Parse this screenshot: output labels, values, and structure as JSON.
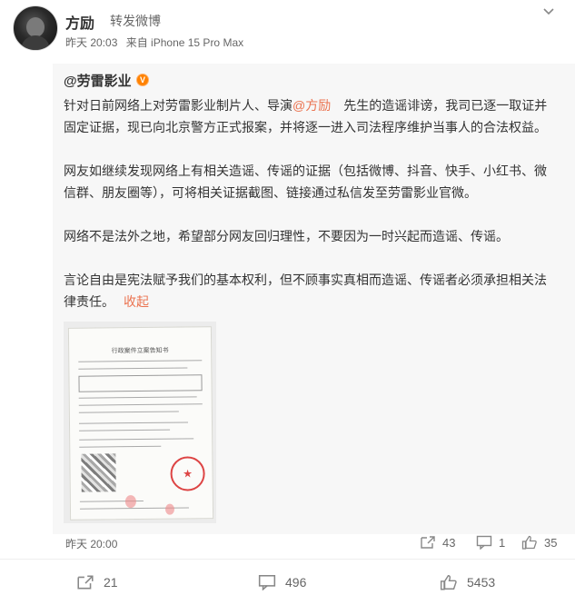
{
  "post": {
    "author": "方励",
    "repost_tag": "转发微博",
    "time": "昨天 20:03",
    "source": "来自 iPhone 15 Pro Max"
  },
  "repost": {
    "author": "@劳雷影业",
    "paragraphs": [
      {
        "pre": "针对日前网络上对劳雷影业制片人、导演",
        "mention": "@方励",
        "post": "　先生的造谣诽谤，我司已逐一取证并固定证据，现已向北京警方正式报案，并将逐一进入司法程序维护当事人的合法权益。"
      },
      {
        "text": "网友如继续发现网络上有相关造谣、传谣的证据（包括微博、抖音、快手、小红书、微信群、朋友圈等），可将相关证据截图、链接通过私信发至劳雷影业官微。"
      },
      {
        "text": "网络不是法外之地，希望部分网友回归理性，不要因为一时兴起而造谣、传谣。"
      },
      {
        "text": "言论自由是宪法赋予我们的基本权利，但不顾事实真相而造谣、传谣者必须承担相关法律责任。"
      }
    ],
    "collapse_label": "收起",
    "doc_title": "行政案件立案告知书",
    "time": "昨天 20:00",
    "forwards": "43",
    "comments": "1",
    "likes": "35"
  },
  "footer": {
    "forwards": "21",
    "comments": "496",
    "likes": "5453"
  },
  "icons": {
    "dropdown": "chevron-down-icon",
    "forward": "forward-icon",
    "comment": "comment-icon",
    "like": "thumbs-up-icon"
  },
  "colors": {
    "mention": "#eb7350",
    "text": "#333333",
    "secondary": "#666666",
    "quote_bg": "#f7f7f7",
    "verified_badge": "#ff8200"
  }
}
